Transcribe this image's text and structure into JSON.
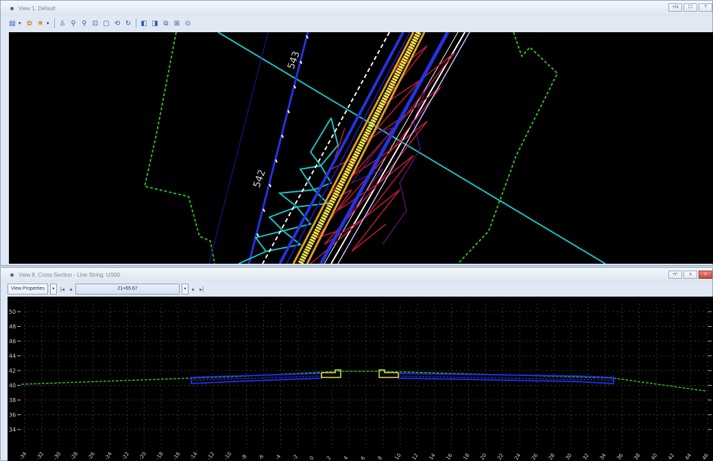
{
  "view1": {
    "title": "View 1, Default",
    "controls": [
      "+/x",
      "☐",
      "?"
    ],
    "contour_labels": [
      "543",
      "542"
    ]
  },
  "view8": {
    "title": "View 8, Cross Section - Line String: US00",
    "view_properties_label": "View Properties",
    "station_value": "21+65.67",
    "controls": [
      "+/-",
      "x",
      "x"
    ],
    "y_ticks": [
      "50",
      "48",
      "46",
      "44",
      "42",
      "40",
      "38",
      "36",
      "34"
    ],
    "x_ticks": [
      "-34",
      "-32",
      "-30",
      "-28",
      "-26",
      "-24",
      "-22",
      "-20",
      "-18",
      "-16",
      "-14",
      "-12",
      "-10",
      "-8",
      "-6",
      "-4",
      "-2",
      "0",
      "2",
      "4",
      "6",
      "8",
      "10",
      "12",
      "14",
      "16",
      "18",
      "20",
      "22",
      "24",
      "26",
      "28",
      "30",
      "32",
      "34",
      "36",
      "38",
      "40",
      "42",
      "44",
      "46"
    ]
  },
  "colors": {
    "canvas_bg": "#000000",
    "existing_ground": "#2fbf1f",
    "pavement": "#1f2fd8",
    "curb": "#e8e23a",
    "alignment": "#19c6c6",
    "grid": "#3a3a3a"
  }
}
